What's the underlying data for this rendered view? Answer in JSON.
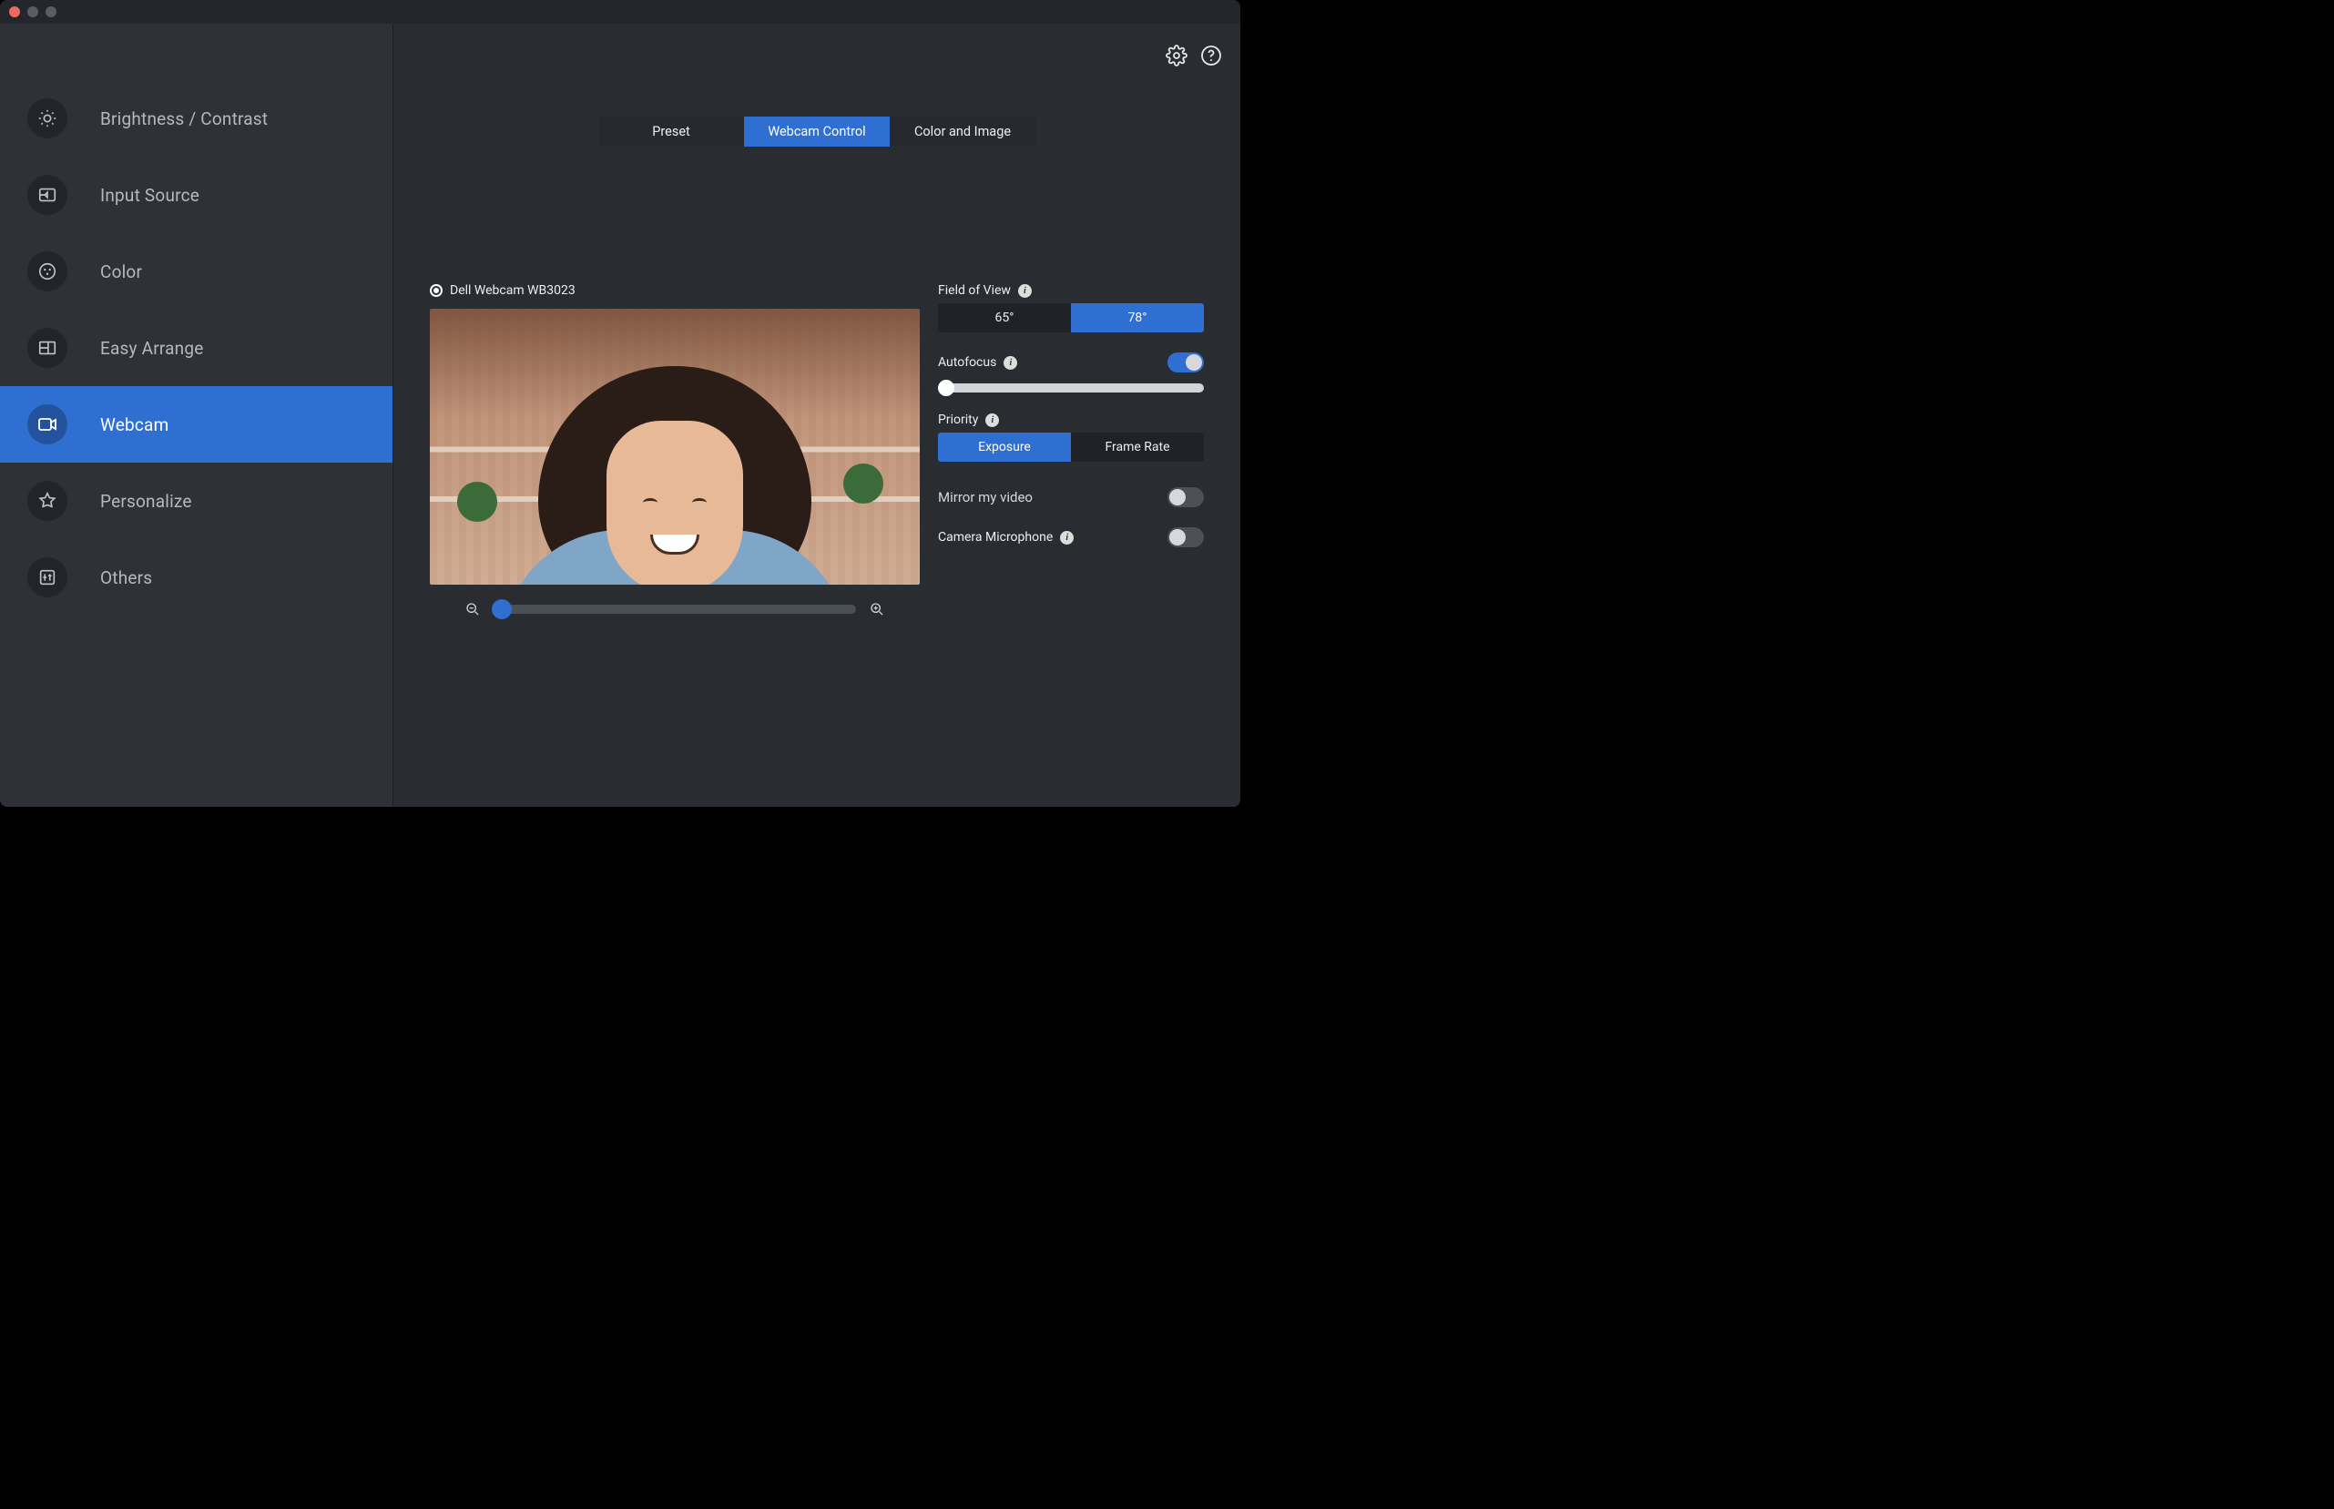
{
  "sidebar": {
    "items": [
      {
        "label": "Brightness / Contrast"
      },
      {
        "label": "Input Source"
      },
      {
        "label": "Color"
      },
      {
        "label": "Easy Arrange"
      },
      {
        "label": "Webcam"
      },
      {
        "label": "Personalize"
      },
      {
        "label": "Others"
      }
    ],
    "active_index": 4
  },
  "tabs": {
    "items": [
      "Preset",
      "Webcam Control",
      "Color and Image"
    ],
    "active_index": 1
  },
  "webcam": {
    "device_label": "Dell Webcam WB3023",
    "zoom_percent": 0
  },
  "controls": {
    "fov": {
      "label": "Field of View",
      "options": [
        "65°",
        "78°"
      ],
      "active_index": 1
    },
    "autofocus": {
      "label": "Autofocus",
      "on": true,
      "focus_value": 0
    },
    "priority": {
      "label": "Priority",
      "options": [
        "Exposure",
        "Frame Rate"
      ],
      "active_index": 0
    },
    "mirror": {
      "label": "Mirror my video",
      "on": false
    },
    "mic": {
      "label": "Camera Microphone",
      "on": false
    }
  }
}
